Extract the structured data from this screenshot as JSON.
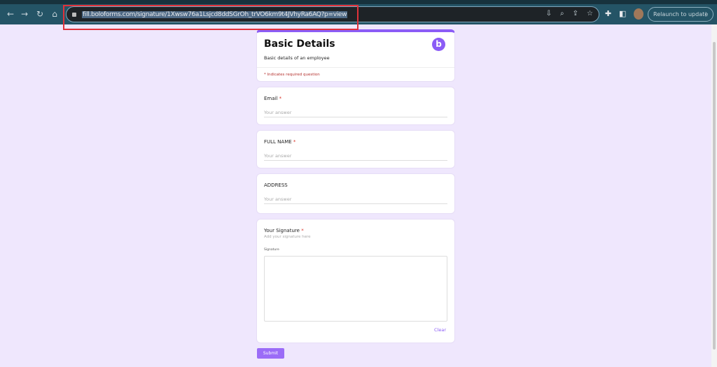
{
  "browser": {
    "url": "fill.boloforms.com/signature/1Xwsw76a1Lsjcd8ddSGrOh_trVO6km9t4JVhyRa6AQ?p=view",
    "relaunch_label": "Relaunch to update"
  },
  "form": {
    "title": "Basic Details",
    "description": "Basic details of an employee",
    "required_note": "* Indicates required question",
    "logo_letter": "b",
    "questions": [
      {
        "label": "Email",
        "required": "*",
        "placeholder": "Your answer"
      },
      {
        "label": "FULL NAME",
        "required": "*",
        "placeholder": "Your answer"
      },
      {
        "label": "ADDRESS",
        "placeholder": "Your answer"
      }
    ],
    "signature": {
      "label": "Your Signature",
      "required": "*",
      "hint": "Add your signature here",
      "pad_label": "Signature",
      "clear_label": "Clear"
    },
    "submit_label": "Submit"
  },
  "colors": {
    "accent": "#8b5cf6",
    "background": "#efe7fd",
    "annotation": "#e0323a"
  }
}
